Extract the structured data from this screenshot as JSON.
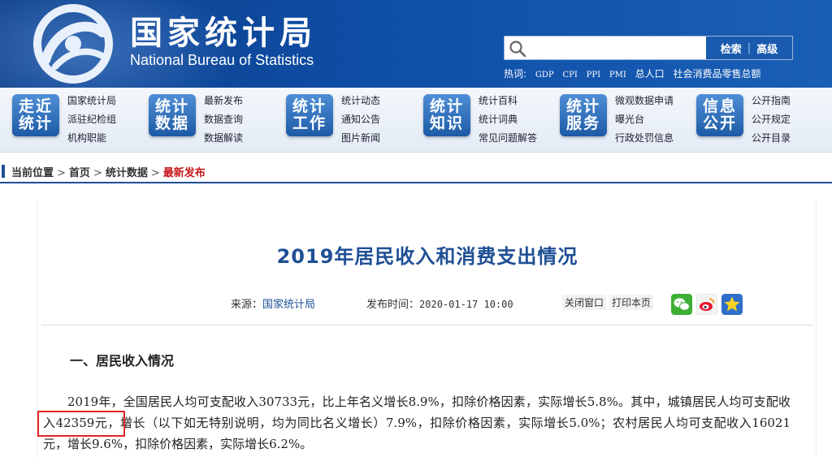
{
  "header": {
    "site_name_cn": "国家统计局",
    "site_name_en": "National Bureau of Statistics",
    "search": {
      "placeholder": "",
      "search_label": "检索",
      "advanced_label": "高级"
    },
    "hot_label": "热词:",
    "hot_words": [
      "GDP",
      "CPI",
      "PPI",
      "PMI",
      "总人口",
      "社会消费品零售总额"
    ]
  },
  "nav": [
    {
      "tile": [
        "走近",
        "统计"
      ],
      "links": [
        "国家统计局",
        "派驻纪检组",
        "机构职能"
      ]
    },
    {
      "tile": [
        "统计",
        "数据"
      ],
      "links": [
        "最新发布",
        "数据查询",
        "数据解读"
      ]
    },
    {
      "tile": [
        "统计",
        "工作"
      ],
      "links": [
        "统计动态",
        "通知公告",
        "图片新闻"
      ]
    },
    {
      "tile": [
        "统计",
        "知识"
      ],
      "links": [
        "统计百科",
        "统计词典",
        "常见问题解答"
      ]
    },
    {
      "tile": [
        "统计",
        "服务"
      ],
      "links": [
        "微观数据申请",
        "曝光台",
        "行政处罚信息"
      ]
    },
    {
      "tile": [
        "信息",
        "公开"
      ],
      "links": [
        "公开指南",
        "公开规定",
        "公开目录"
      ]
    }
  ],
  "breadcrumb": {
    "label": "当前位置",
    "items": [
      "首页",
      "统计数据"
    ],
    "current": "最新发布"
  },
  "article": {
    "title": "2019年居民收入和消费支出情况",
    "source_label": "来源：",
    "source": "国家统计局",
    "date_label": "发布时间：",
    "date": "2020-01-17 10:00",
    "close_label": "关闭窗口",
    "print_label": "打印本页",
    "share_icons": [
      "wechat-icon",
      "weibo-icon",
      "favorite-star-icon"
    ],
    "section_heading": "一、居民收入情况",
    "paragraph": "2019年，全国居民人均可支配收入30733元，比上年名义增长8.9%，扣除价格因素，实际增长5.8%。其中，城镇居民人均可支配收入42359元，增长（以下如无特别说明，均为同比名义增长）7.9%，扣除价格因素，实际增长5.0%；农村居民人均可支配收入16021元，增长9.6%，扣除价格因素，实际增长6.2%。"
  },
  "colors": {
    "brand_blue": "#1f4f95",
    "header_blue": "#0f4ea6",
    "current_red": "#c8171d",
    "highlight_red": "#e02424"
  }
}
